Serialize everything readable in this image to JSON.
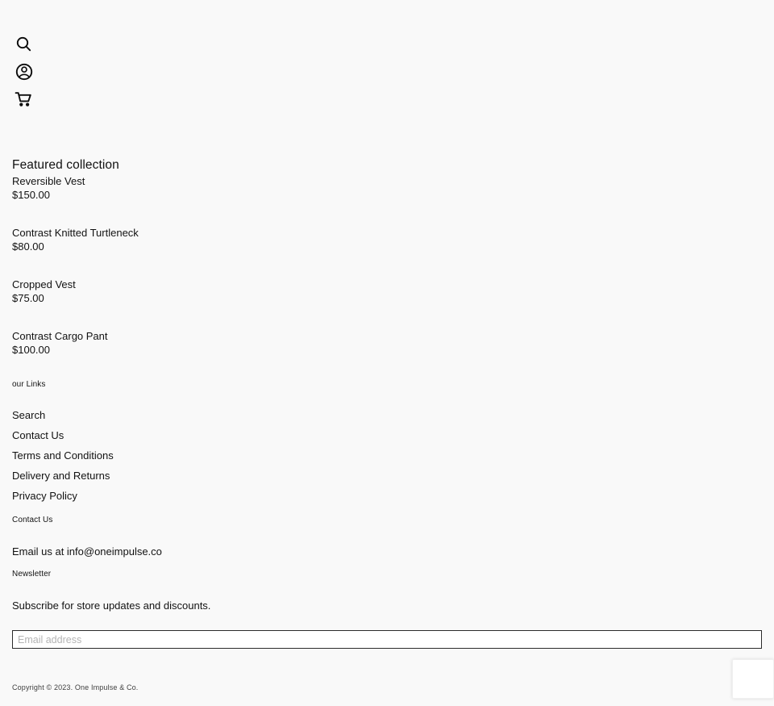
{
  "site": {
    "background_color": "#f9f9f9",
    "text_color": "#121212"
  },
  "header": {
    "icons": [
      {
        "name": "search-icon",
        "label": "Search"
      },
      {
        "name": "account-icon",
        "label": "Log in"
      },
      {
        "name": "cart-icon",
        "label": "Cart"
      }
    ]
  },
  "featured": {
    "title": "Featured collection",
    "products": [
      {
        "name": "Reversible Vest",
        "price": "$150.00"
      },
      {
        "name": "Contrast Knitted Turtleneck",
        "price": "$80.00"
      },
      {
        "name": "Cropped Vest",
        "price": "$75.00"
      },
      {
        "name": "Contrast Cargo Pant",
        "price": "$100.00"
      }
    ]
  },
  "footer": {
    "links_heading": "our Links",
    "links": [
      {
        "label": "Search"
      },
      {
        "label": "Contact Us"
      },
      {
        "label": "Terms and Conditions"
      },
      {
        "label": "Delivery and Returns"
      },
      {
        "label": "Privacy Policy"
      }
    ],
    "contact": {
      "heading": "Contact Us",
      "text": "Email us at info@oneimpulse.co"
    },
    "newsletter": {
      "heading": "Newsletter",
      "blurb": "Subscribe for store updates and discounts.",
      "email_placeholder": "Email address",
      "email_value": ""
    },
    "copyright": "Copyright © 2023. One Impulse & Co."
  }
}
